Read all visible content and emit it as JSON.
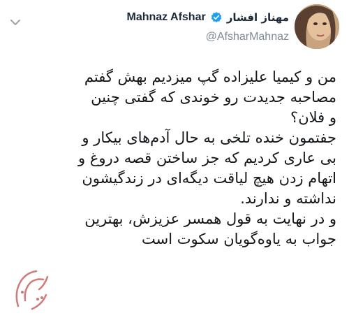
{
  "tweet": {
    "author": {
      "name_persian": "مهناز افشار",
      "name_latin": "Mahnaz Afshar",
      "handle": "@AfsharMahnaz",
      "verified_icon": "verified-badge-icon",
      "avatar": "author-avatar"
    },
    "menu_icon": "chevron-down-icon",
    "body_lines": [
      "من و کیمیا علیزاده گپ میزدیم بهش گفتم",
      "مصاحبه جدیدت رو خوندی که گفتی چنین",
      "و فلان؟",
      "جفتمون خنده تلخی به حال آدم‌های بیکار و",
      "بی عاری کردیم که جز ساختن قصه دروغ و",
      "اتهام زدن هیچ لیاقت دیگه‌ای در زندگیشون",
      "نداشته و ندارند.",
      "و در نهایت به قول همسر عزیزش، بهترین",
      "جواب به یاوه‌گویان سکوت است"
    ],
    "colors": {
      "text": "#14171a",
      "handle": "#7d8a97",
      "verified": "#1da1f2",
      "chevron": "#9aa4ad"
    }
  },
  "watermark": {
    "icon": "site-logo-watermark"
  }
}
